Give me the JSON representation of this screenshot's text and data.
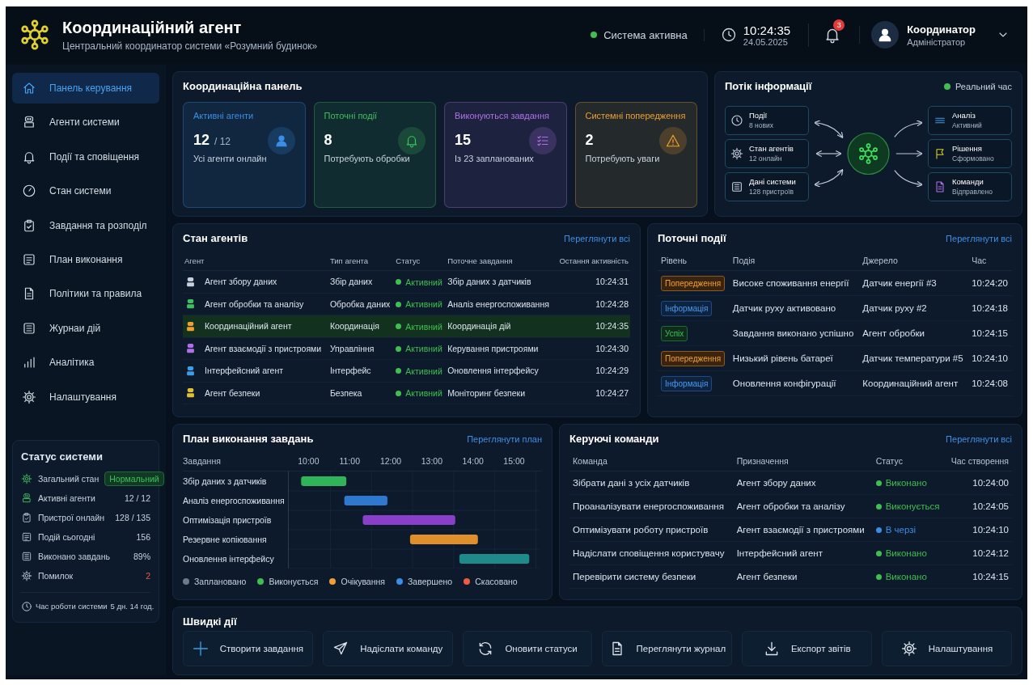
{
  "header": {
    "title": "Координаційний агент",
    "subtitle": "Центральний координатор системи «Розумний будинок»",
    "status": {
      "label": "Система активна",
      "color": "#3fbf4f"
    },
    "time": "10:24:35",
    "date": "24.05.2025",
    "notifications": "3",
    "user": {
      "name": "Координатор",
      "role": "Адміністратор"
    }
  },
  "sidebar": {
    "items": [
      {
        "label": "Панель керування",
        "selected": true
      },
      {
        "label": "Агенти системи",
        "selected": false
      },
      {
        "label": "Події та сповіщення",
        "selected": false
      },
      {
        "label": "Стан системи",
        "selected": false
      },
      {
        "label": "Завдання та розподіл",
        "selected": false
      },
      {
        "label": "План виконання",
        "selected": false
      },
      {
        "label": "Політики та правила",
        "selected": false
      },
      {
        "label": "Журнаи дій",
        "selected": false
      },
      {
        "label": "Аналітика",
        "selected": false
      },
      {
        "label": "Налаштування",
        "selected": false
      }
    ],
    "status": {
      "title": "Статус системи",
      "rows": [
        {
          "label": "Загальний стан",
          "value": "Нормальний",
          "kind": "badge"
        },
        {
          "label": "Активні агенти",
          "value": "12 / 12",
          "kind": "plain"
        },
        {
          "label": "Пристрої онлайн",
          "value": "128 / 135",
          "kind": "plain"
        },
        {
          "label": "Подій сьогодні",
          "value": "156",
          "kind": "plain"
        },
        {
          "label": "Виконано завдань",
          "value": "89%",
          "kind": "plain"
        },
        {
          "label": "Помилок",
          "value": "2",
          "kind": "error"
        }
      ],
      "uptime": {
        "label": "Час роботи системи",
        "value": "5 дн. 14 год."
      }
    }
  },
  "coordination_panel": {
    "title": "Координаційна панель",
    "cards": [
      {
        "title": "Активні агенти",
        "value": "12",
        "total": "/ 12",
        "note": "Усі агенти онлайн",
        "color": "#3b8ee8"
      },
      {
        "title": "Поточні події",
        "value": "8",
        "note": "Потребують обробки",
        "color": "#3fbf5f"
      },
      {
        "title": "Виконуються завдання",
        "value": "15",
        "note": "Із 23 запланованих",
        "color": "#b070e8"
      },
      {
        "title": "Системні попередження",
        "value": "2",
        "note": "Потребують уваги",
        "color": "#f0a030"
      }
    ]
  },
  "information_flow": {
    "title": "Потік інформації",
    "live": "Реальний час",
    "inputs": [
      {
        "title": "Події",
        "note": "8 нових"
      },
      {
        "title": "Стан агентів",
        "note": "12 онлайн"
      },
      {
        "title": "Дані системи",
        "note": "128 пристроїв"
      }
    ],
    "outputs": [
      {
        "title": "Аналіз",
        "note": "Активний"
      },
      {
        "title": "Рішення",
        "note": "Сформовано"
      },
      {
        "title": "Команди",
        "note": "Відправлено"
      }
    ]
  },
  "agents": {
    "title": "Стан агентів",
    "link": "Переглянути всі",
    "columns": [
      "Агент",
      "Тип агента",
      "Статус",
      "Поточне завдання",
      "Остання активність"
    ],
    "rows": [
      {
        "name": "Агент збору даних",
        "type": "Збір даних",
        "status": "Активний",
        "task": "Збір даних з датчиків",
        "last": "10:24:31",
        "color": "#c8d0dc",
        "selected": false
      },
      {
        "name": "Агент обробки та аналізу",
        "type": "Обробка даних",
        "status": "Активний",
        "task": "Аналіз енергоспоживання",
        "last": "10:24:28",
        "color": "#3fbf5f",
        "selected": false
      },
      {
        "name": "Координаційний агент",
        "type": "Координація",
        "status": "Активний",
        "task": "Координація дій",
        "last": "10:24:35",
        "color": "#f0a030",
        "selected": true
      },
      {
        "name": "Агент взаємодії з пристроями",
        "type": "Управління",
        "status": "Активний",
        "task": "Керування пристроями",
        "last": "10:24:30",
        "color": "#b070e8",
        "selected": false
      },
      {
        "name": "Інтерфейсний агент",
        "type": "Інтерфейс",
        "status": "Активний",
        "task": "Оновлення інтерфейсу",
        "last": "10:24:29",
        "color": "#3b9ee8",
        "selected": false
      },
      {
        "name": "Агент безпеки",
        "type": "Безпека",
        "status": "Активний",
        "task": "Моніторинг безпеки",
        "last": "10:24:27",
        "color": "#e0c030",
        "selected": false
      }
    ]
  },
  "events": {
    "title": "Поточні події",
    "link": "Переглянути всі",
    "columns": [
      "Рівень",
      "Подія",
      "Джерело",
      "Час"
    ],
    "rows": [
      {
        "level": "Попередження",
        "kind": "warning",
        "event": "Високе споживання енергії",
        "source": "Датчик енергії #3",
        "time": "10:24:20"
      },
      {
        "level": "Інформація",
        "kind": "info",
        "event": "Датчик руху активовано",
        "source": "Датчик руху #2",
        "time": "10:24:18"
      },
      {
        "level": "Успіх",
        "kind": "success",
        "event": "Завдання виконано успішно",
        "source": "Агент обробки",
        "time": "10:24:15"
      },
      {
        "level": "Попередження",
        "kind": "warning",
        "event": "Низький рівень батареї",
        "source": "Датчик температури #5",
        "time": "10:24:10"
      },
      {
        "level": "Інформація",
        "kind": "info",
        "event": "Оновлення конфігурації",
        "source": "Координаційний агент",
        "time": "10:24:08"
      }
    ]
  },
  "plan": {
    "title": "План виконання завдань",
    "link": "Переглянути план",
    "task_header": "Завдання",
    "tasks": [
      "Збір даних з датчиків",
      "Аналіз енергоспоживання",
      "Оптимізація пристроїв",
      "Резервне копіювання",
      "Оновлення інтерфейсу"
    ],
    "time_labels": [
      "10:00",
      "11:00",
      "12:00",
      "13:00",
      "14:00",
      "15:00"
    ],
    "legend": [
      {
        "label": "Заплановано",
        "color": "#6b7a8f"
      },
      {
        "label": "Виконується",
        "color": "#3fbf4f"
      },
      {
        "label": "Очікування",
        "color": "#f0a030"
      },
      {
        "label": "Завершено",
        "color": "#3b8ee8"
      },
      {
        "label": "Скасовано",
        "color": "#f05a40"
      }
    ]
  },
  "commands": {
    "title": "Керуючі команди",
    "link": "Переглянути всі",
    "columns": [
      "Команда",
      "Призначення",
      "Статус",
      "Час створення"
    ],
    "rows": [
      {
        "command": "Зібрати дані з усіх датчиків",
        "target": "Агент збору даних",
        "status": "Виконано",
        "color": "#3fbf4f",
        "time": "10:24:00"
      },
      {
        "command": "Проаналізувати енергоспоживання",
        "target": "Агент обробки та аналізу",
        "status": "Виконується",
        "color": "#3fbf4f",
        "time": "10:24:05"
      },
      {
        "command": "Оптимізувати роботу пристроїв",
        "target": "Агент взаємодії з пристроями",
        "status": "В черзі",
        "color": "#3b8ee8",
        "time": "10:24:10"
      },
      {
        "command": "Надіслати сповіщення користувачу",
        "target": "Інтерфейсний агент",
        "status": "Виконано",
        "color": "#3fbf4f",
        "time": "10:24:12"
      },
      {
        "command": "Перевірити систему безпеки",
        "target": "Агент безпеки",
        "status": "Виконано",
        "color": "#3fbf4f",
        "time": "10:24:15"
      }
    ]
  },
  "quick_actions": {
    "title": "Швидкі дії",
    "buttons": [
      "Створити завдання",
      "Надіслати команду",
      "Оновити статуси",
      "Переглянути журнал",
      "Експорт звітів",
      "Налаштування"
    ]
  }
}
